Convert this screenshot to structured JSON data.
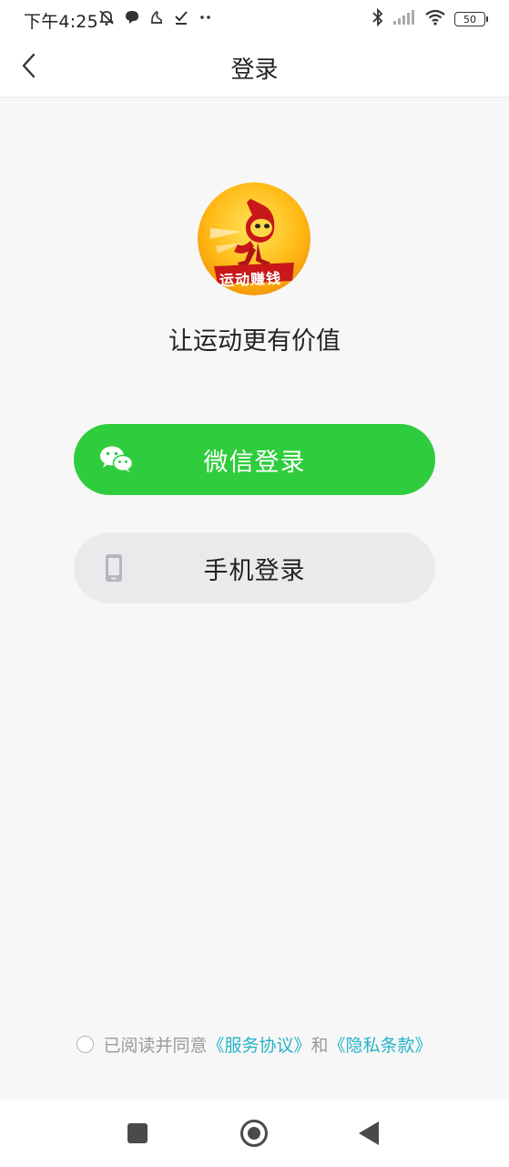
{
  "status_bar": {
    "time": "下午4:25",
    "battery": "50",
    "icons": [
      "mute-bell-icon",
      "chat-bubble-icon",
      "notification-icon",
      "checkmark-icon",
      "more-dots-icon",
      "bluetooth-icon",
      "signal-icon",
      "wifi-icon",
      "battery-icon"
    ]
  },
  "nav": {
    "title": "登录",
    "back_icon": "chevron-left-icon"
  },
  "logo": {
    "text": "运动赚钱",
    "icon": "runner-mascot-logo"
  },
  "slogan": "让运动更有价值",
  "buttons": {
    "wechat": {
      "label": "微信登录",
      "icon": "wechat-icon",
      "color": "#2fcc3d"
    },
    "phone": {
      "label": "手机登录",
      "icon": "phone-icon",
      "color": "#eaeaec"
    }
  },
  "agreement": {
    "prefix": "已阅读并同意",
    "service_link": "《服务协议》",
    "joiner": "和",
    "privacy_link": "《隐私条款》",
    "link_color": "#26b3c7"
  },
  "system_nav": {
    "icons": [
      "recent-apps-icon",
      "home-icon",
      "back-triangle-icon"
    ]
  }
}
